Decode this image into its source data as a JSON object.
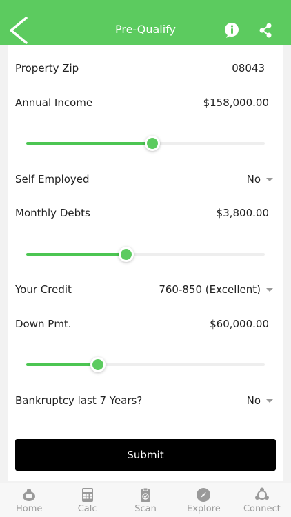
{
  "header": {
    "title": "Pre-Qualify"
  },
  "form": {
    "zip": {
      "label": "Property Zip",
      "value": "08043"
    },
    "income": {
      "label": "Annual Income",
      "value": "$158,000.00",
      "slider": 0.53
    },
    "self_employed": {
      "label": "Self Employed",
      "value": "No"
    },
    "debts": {
      "label": "Monthly Debts",
      "value": "$3,800.00",
      "slider": 0.42
    },
    "credit": {
      "label": "Your Credit",
      "value": "760-850 (Excellent)"
    },
    "down": {
      "label": "Down Pmt.",
      "value": "$60,000.00",
      "slider": 0.3
    },
    "bankruptcy": {
      "label": "Bankruptcy last 7 Years?",
      "value": "No"
    },
    "submit_label": "Submit"
  },
  "tabs": [
    {
      "label": "Home",
      "icon": "home-icon"
    },
    {
      "label": "Calc",
      "icon": "calculator-icon"
    },
    {
      "label": "Scan",
      "icon": "clipboard-icon"
    },
    {
      "label": "Explore",
      "icon": "compass-icon"
    },
    {
      "label": "Connect",
      "icon": "connect-icon"
    }
  ],
  "colors": {
    "header": "#5ccb5f",
    "accent": "#4cc552",
    "button": "#000000"
  }
}
